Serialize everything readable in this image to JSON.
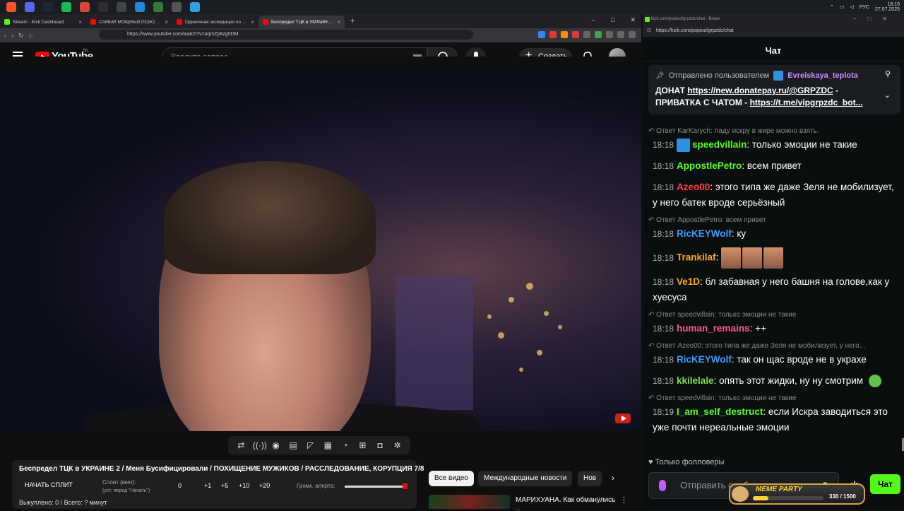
{
  "taskbar": {
    "icons": [
      {
        "name": "brave",
        "color": "#fb542b"
      },
      {
        "name": "discord",
        "color": "#5865f2"
      },
      {
        "name": "steam",
        "color": "#1b2838"
      },
      {
        "name": "spotify",
        "color": "#1db954"
      },
      {
        "name": "chrome",
        "color": "#db4437"
      },
      {
        "name": "obs",
        "color": "#302e31"
      },
      {
        "name": "xbox",
        "color": "#444"
      },
      {
        "name": "player",
        "color": "#1e88e5"
      },
      {
        "name": "app-green",
        "color": "#2e7d32"
      },
      {
        "name": "app-tray",
        "color": "#555"
      },
      {
        "name": "telegram",
        "color": "#2aa3e0"
      }
    ],
    "lang": "РУС",
    "time": "18:19",
    "date": "27.07.2025"
  },
  "left_browser": {
    "tabs": [
      {
        "title": "Stream - Kick Dashboard",
        "color": "#53fc18",
        "active": false
      },
      {
        "title": "САМЫЙ МОЩНЫЙ ПСИОП НА РУ...",
        "color": "#ff0000",
        "active": false
      },
      {
        "title": "Одиночная экспедиция по Примор...",
        "color": "#ff0000",
        "active": false
      },
      {
        "title": "Беспредел ТЦК в УКРАИНЕ 2...",
        "color": "#ff0000",
        "active": true
      }
    ],
    "url": "https://www.youtube.com/watch?v=oqmZp8zg0DM"
  },
  "youtube": {
    "logo": "YouTube",
    "region": "NL",
    "search_placeholder": "Введите запрос",
    "create_label": "Создать",
    "video_title": "Беспредел ТЦК в УКРАИНЕ 2 / Меня Бусифицировали / ПОХИЩЕНИЕ МУЖИКОВ / РАССЛЕДОВАНИЕ, КОРУПЦИЯ 7/8",
    "split_panel": {
      "start_label": "НАЧАТЬ СПЛИТ",
      "split_label": "Сплит (мин):",
      "split_hint": "(уст. перед \"Начать\")",
      "values": [
        "0",
        "+1",
        "+5",
        "+10",
        "+20"
      ],
      "volume_label": "Громк. алерта:",
      "volume_level": 0.98,
      "footer": "Выкуплено: 0 / Всего: ? минут"
    },
    "chips": [
      "Все видео",
      "Международные новости",
      "Нов"
    ],
    "rec_title": "МАРИХУАНА. Как обманулись",
    "rec_sub": "..."
  },
  "right_browser": {
    "window_title": "kick.com/popout/grpzdc/chat - Brave",
    "url": "https://kick.com/popout/grpzdc/chat",
    "chat_title": "Чат",
    "pinned": {
      "prefix": "Отправлено пользователем",
      "user": "Evreiskaya_teplota",
      "line1_text": "ДОНАТ ",
      "line1_link": "https://new.donatepay.ru/@GRPZDC",
      "line1_tail": " -",
      "line2_text": "ПРИВАТКА С ЧАТОМ - ",
      "line2_link": "https://t.me/vipgrpzdc_bot..."
    },
    "messages": [
      {
        "reply": "Ответ KarKarych: ладу искру в жире можно взять.",
        "time": "18:18",
        "user": "speedvillain",
        "color": "#53fc18",
        "badge": true,
        "text": "только эмоции не такие"
      },
      {
        "reply": "",
        "time": "18:18",
        "user": "AppostlePetro",
        "color": "#53fc18",
        "badge": false,
        "text": "всем привет"
      },
      {
        "reply": "",
        "time": "18:18",
        "user": "Azeo00",
        "color": "#ff3b3b",
        "badge": false,
        "text": "этого типа же даже Зеля не мобилизует, у него батек вроде серьёзный"
      },
      {
        "reply": "Ответ AppostlePetro: всем привет",
        "time": "18:18",
        "user": "RicKEYWolf",
        "color": "#3b9bff",
        "badge": false,
        "text": "ку"
      },
      {
        "reply": "",
        "time": "18:18",
        "user": "Trankilaf",
        "color": "#f5a623",
        "badge": false,
        "text": "",
        "emotes": 3
      },
      {
        "reply": "",
        "time": "18:18",
        "user": "Ve1D",
        "color": "#f5a623",
        "badge": false,
        "text": "бл забавная у него башня на голове,как у хуесуса"
      },
      {
        "reply": "Ответ speedvillain: только эмоции не такие",
        "time": "18:18",
        "user": "human_remains",
        "color": "#ff5a8a",
        "badge": false,
        "text": "++"
      },
      {
        "reply": "Ответ Azeo00: этого типа же даже Зеля не мобилизует, у него...",
        "time": "18:18",
        "user": "RicKEYWolf",
        "color": "#3b9bff",
        "badge": false,
        "text": "так он щас вроде не в украхе"
      },
      {
        "reply": "",
        "time": "18:18",
        "user": "kkilelale",
        "color": "#7dde4a",
        "badge": false,
        "text": "опять этот жидки, ну ну смотрим",
        "small_emote": true
      },
      {
        "reply": "Ответ speedvillain: только эмоции не такие",
        "time": "18:19",
        "user": "I_am_self_destruct",
        "color": "#53fc18",
        "badge": false,
        "text": "если Искра заводиться это уже почти нереальные эмоции"
      }
    ],
    "followers_only": "Только фолловеры",
    "input_placeholder": "Отправить сообщение",
    "chat_button": "Чат",
    "meme_party": {
      "title": "MEME PARTY",
      "progress": "330 / 1500",
      "fraction": 0.22
    }
  }
}
